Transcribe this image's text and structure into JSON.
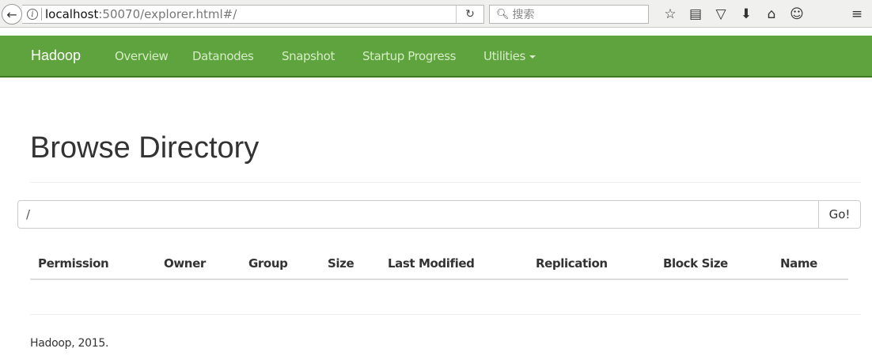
{
  "browser": {
    "url_host": "localhost",
    "url_rest": ":50070/explorer.html#/",
    "search_placeholder": "搜索",
    "icons": [
      "back-icon",
      "info-icon",
      "reload-icon",
      "search-icon",
      "bookmark-star-icon",
      "reader-view-icon",
      "pocket-icon",
      "download-icon",
      "home-icon",
      "chat-icon",
      "menu-icon"
    ]
  },
  "navbar": {
    "brand": "Hadoop",
    "items": [
      {
        "label": "Overview"
      },
      {
        "label": "Datanodes"
      },
      {
        "label": "Snapshot"
      },
      {
        "label": "Startup Progress"
      },
      {
        "label": "Utilities"
      }
    ],
    "color": "#5fa33e"
  },
  "page": {
    "title": "Browse Directory",
    "path_value": "/",
    "go_label": "Go!"
  },
  "table": {
    "columns": [
      "Permission",
      "Owner",
      "Group",
      "Size",
      "Last Modified",
      "Replication",
      "Block Size",
      "Name"
    ],
    "rows": []
  },
  "footer": {
    "text": "Hadoop, 2015."
  }
}
